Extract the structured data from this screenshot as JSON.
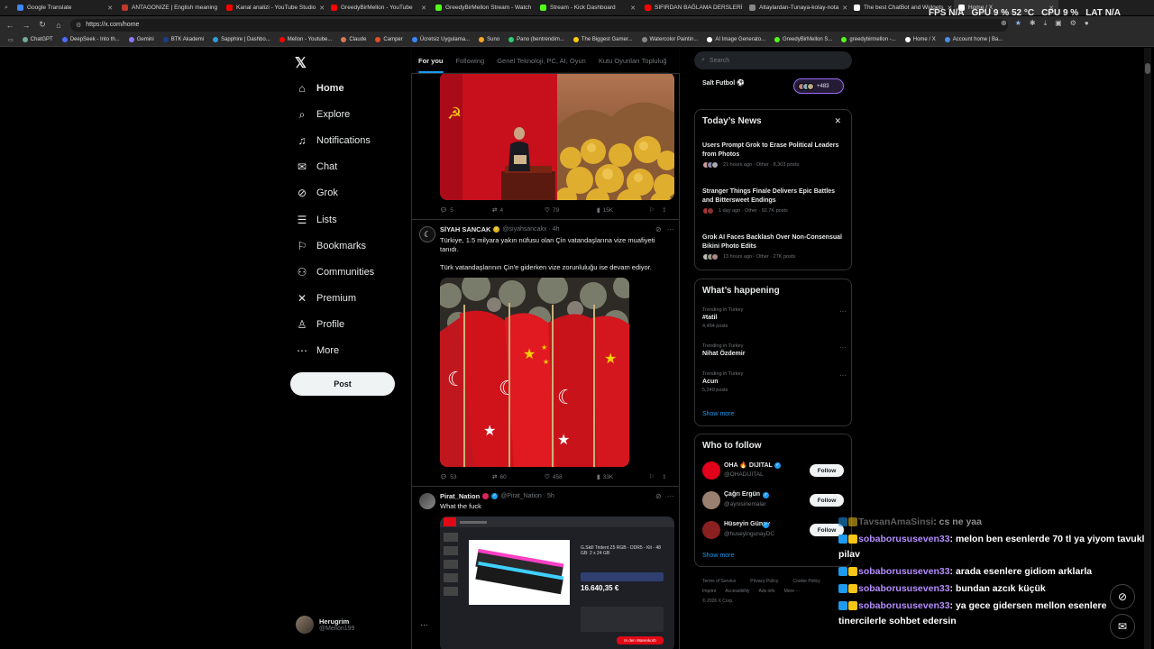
{
  "browser": {
    "tabs": [
      {
        "title": "Google Translate",
        "color": "#4285f4"
      },
      {
        "title": "ANTAGONIZE | English meaning",
        "color": "#c0392b"
      },
      {
        "title": "Kanal analizi - YouTube Studio",
        "color": "#ff0000"
      },
      {
        "title": "GreedyBirMellon - YouTube",
        "color": "#ff0000"
      },
      {
        "title": "GreedyBirMellon Stream - Watch",
        "color": "#53fc18"
      },
      {
        "title": "Stream - Kick Dashboard",
        "color": "#53fc18"
      },
      {
        "title": "SIFIRDAN BAĞLAMA DERSLERİ",
        "color": "#ff0000"
      },
      {
        "title": "Altaylardan-Tunaya-kolay-nota",
        "color": "#888888"
      },
      {
        "title": "The best ChatBot and Widgets",
        "color": "#ffffff"
      },
      {
        "title": "Home / X",
        "color": "#ffffff"
      }
    ],
    "url": "https://x.com/home",
    "bookmarks": [
      "ChatGPT",
      "DeepSeek - Into th...",
      "Gemini",
      "BTK Akademi",
      "Sapphire | Dashbo...",
      "Mellon - Youtube...",
      "Claude",
      "Camper",
      "Ücretsiz Uygulama...",
      "Suno",
      "Pano (bentrendim...",
      "The Biggest Gamer...",
      "Watercolor Paintin...",
      "AI Image Generato...",
      "GreedyBirMellon S...",
      "greedybirmellon -...",
      "Home / X",
      "Account home | Ba..."
    ]
  },
  "hud": {
    "fps_label": "FPS",
    "fps": "N/A",
    "gpu_label": "GPU",
    "gpu": "9 %",
    "gpu_temp": "52 °C",
    "cpu_label": "CPU",
    "cpu": "9 %",
    "lat_label": "LAT",
    "lat": "N/A"
  },
  "sidebar": {
    "items": [
      {
        "label": "Home",
        "icon": "home-icon",
        "glyph": "⌂"
      },
      {
        "label": "Explore",
        "icon": "search-icon",
        "glyph": "⌕"
      },
      {
        "label": "Notifications",
        "icon": "bell-icon",
        "glyph": "♫"
      },
      {
        "label": "Chat",
        "icon": "mail-icon",
        "glyph": "✉"
      },
      {
        "label": "Grok",
        "icon": "grok-icon",
        "glyph": "⊘"
      },
      {
        "label": "Lists",
        "icon": "list-icon",
        "glyph": "☰"
      },
      {
        "label": "Bookmarks",
        "icon": "bookmark-icon",
        "glyph": "⚐"
      },
      {
        "label": "Communities",
        "icon": "communities-icon",
        "glyph": "⚇"
      },
      {
        "label": "Premium",
        "icon": "x-premium-icon",
        "glyph": "✕"
      },
      {
        "label": "Profile",
        "icon": "profile-icon",
        "glyph": "♙"
      },
      {
        "label": "More",
        "icon": "more-icon",
        "glyph": "⋯"
      }
    ],
    "post_label": "Post",
    "profile": {
      "name": "Herugrim",
      "handle": "@Mellon199"
    }
  },
  "feed": {
    "tabs": [
      "For you",
      "Following",
      "Genel Teknoloji, PC, AI, Oyun",
      "Kutu Oyunları Topluluğ"
    ],
    "tweet1": {
      "replies": "5",
      "retweets": "4",
      "likes": "79",
      "views": "15K"
    },
    "tweet2": {
      "name": "SİYAH SANCAK",
      "handle": "@siyahsancakx · 4h",
      "text1": "Türkiye, 1.5 milyara yakın nüfusu olan Çin vatandaşlarına vize muafiyeti tanıdı.",
      "text2": "Türk vatandaşlarının Çin'e giderken vize zorunluluğu ise devam ediyor.",
      "replies": "53",
      "retweets": "60",
      "likes": "458",
      "views": "33K"
    },
    "tweet3": {
      "name": "Pirat_Nation",
      "handle": "@Pirat_Nation · 5h",
      "text": "What the fuck",
      "shop": {
        "product": "G.Skill Trident Z5 RGB - DDR5 - Kit - 48 GB: 2 x 24 GB",
        "price": "16.640,35 €",
        "cart": "In den Warenkorb"
      }
    }
  },
  "right": {
    "search_placeholder": "Search",
    "top_community": {
      "name": "Salt Futbol ⚽",
      "count": "+483"
    },
    "news": {
      "title": "Today’s News",
      "items": [
        {
          "headline": "Users Prompt Grok to Erase Political Leaders from Photos",
          "meta": "21 hours ago · Other · 8,303 posts"
        },
        {
          "headline": "Stranger Things Finale Delivers Epic Battles and Bittersweet Endings",
          "meta": "1 day ago · Other · 92.7K posts"
        },
        {
          "headline": "Grok AI Faces Backlash Over Non-Consensual Bikini Photo Edits",
          "meta": "13 hours ago · Other · 27K posts"
        }
      ]
    },
    "happening": {
      "title": "What’s happening",
      "items": [
        {
          "context": "Trending in Turkey",
          "name": "#tatil",
          "posts": "4,494 posts"
        },
        {
          "context": "Trending in Turkey",
          "name": "Nihat Özdemir",
          "posts": ""
        },
        {
          "context": "Trending in Turkey",
          "name": "Acun",
          "posts": "5,240 posts"
        }
      ],
      "show_more": "Show more"
    },
    "who_to_follow": {
      "title": "Who to follow",
      "items": [
        {
          "name": "OHA 🔥 DIJITAL",
          "handle": "@OHADIJITAL"
        },
        {
          "name": "Çağrı Ergün",
          "handle": "@aynisinemalar"
        },
        {
          "name": "Hüseyin Günay",
          "handle": "@huseyingunayDC"
        }
      ],
      "follow_label": "Follow",
      "show_more": "Show more"
    },
    "footer": {
      "line1": [
        "Terms of Service",
        "Privacy Policy",
        "Cookie Policy"
      ],
      "line2": [
        "Imprint",
        "Accessibility",
        "Ads info",
        "More ···"
      ],
      "copyright": "© 2026 X Corp."
    }
  },
  "chat": [
    {
      "user": "TavsanAmaSinsi",
      "msg": ": cs ne yaa"
    },
    {
      "user": "sobaborususeven33",
      "msg": ": melon ben esenlerde 70 tl ya yiyom tavuklu"
    },
    {
      "user": "",
      "msg": "pilav"
    },
    {
      "user": "sobaborususeven33",
      "msg": ": arada esenlere gidiom arklarla"
    },
    {
      "user": "sobaborususeven33",
      "msg": ": bundan azcık küçük"
    },
    {
      "user": "sobaborususeven33",
      "msg": ": ya gece gidersen mellon esenlere"
    },
    {
      "user": "",
      "msg": "tinercilerle sohbet edersin"
    }
  ]
}
